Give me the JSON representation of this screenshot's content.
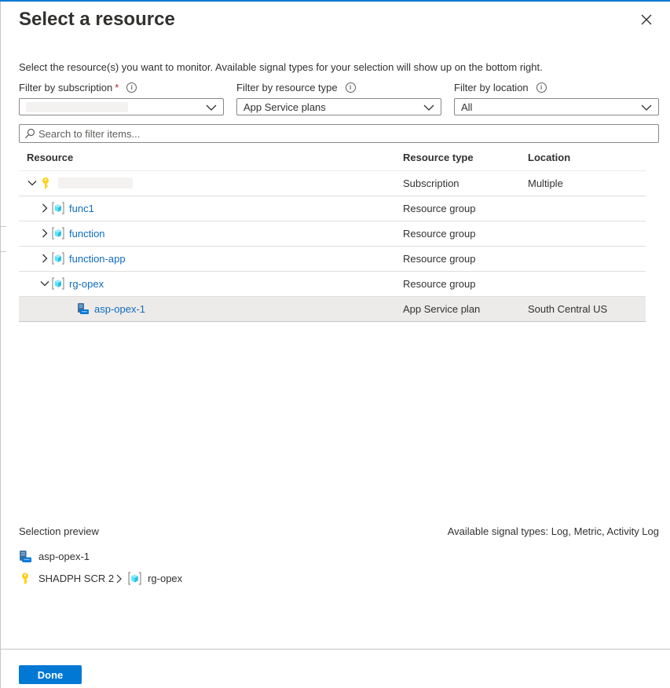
{
  "title": "Select a resource",
  "description": "Select the resource(s) you want to monitor. Available signal types for your selection will show up on the bottom right.",
  "filters": {
    "subscription": {
      "label": "Filter by subscription",
      "required_mark": "*",
      "value": ""
    },
    "resource_type": {
      "label": "Filter by resource type",
      "value": "App Service plans"
    },
    "location": {
      "label": "Filter by location",
      "value": "All"
    }
  },
  "search": {
    "placeholder": "Search to filter items..."
  },
  "table": {
    "headers": {
      "resource": "Resource",
      "type": "Resource type",
      "location": "Location"
    },
    "rows": [
      {
        "name": "",
        "type": "Subscription",
        "location": "Multiple"
      },
      {
        "name": "func1",
        "type": "Resource group",
        "location": ""
      },
      {
        "name": "function",
        "type": "Resource group",
        "location": ""
      },
      {
        "name": "function-app",
        "type": "Resource group",
        "location": ""
      },
      {
        "name": "rg-opex",
        "type": "Resource group",
        "location": ""
      },
      {
        "name": "asp-opex-1",
        "type": "App Service plan",
        "location": "South Central US"
      }
    ]
  },
  "preview": {
    "label": "Selection preview",
    "signals": "Available signal types: Log, Metric, Activity Log",
    "item": "asp-opex-1",
    "subscription": "SHADPH SCR 2",
    "group": "rg-opex"
  },
  "footer": {
    "done": "Done"
  },
  "colors": {
    "accent": "#0078d4",
    "link": "#0f6cbd",
    "selected_row": "#edebe9",
    "required": "#a4262c"
  },
  "icons": [
    "close-icon",
    "info-icon",
    "chevron-down-icon",
    "search-icon",
    "chevron-right-icon",
    "key-icon",
    "resource-group-icon",
    "app-service-plan-icon"
  ]
}
